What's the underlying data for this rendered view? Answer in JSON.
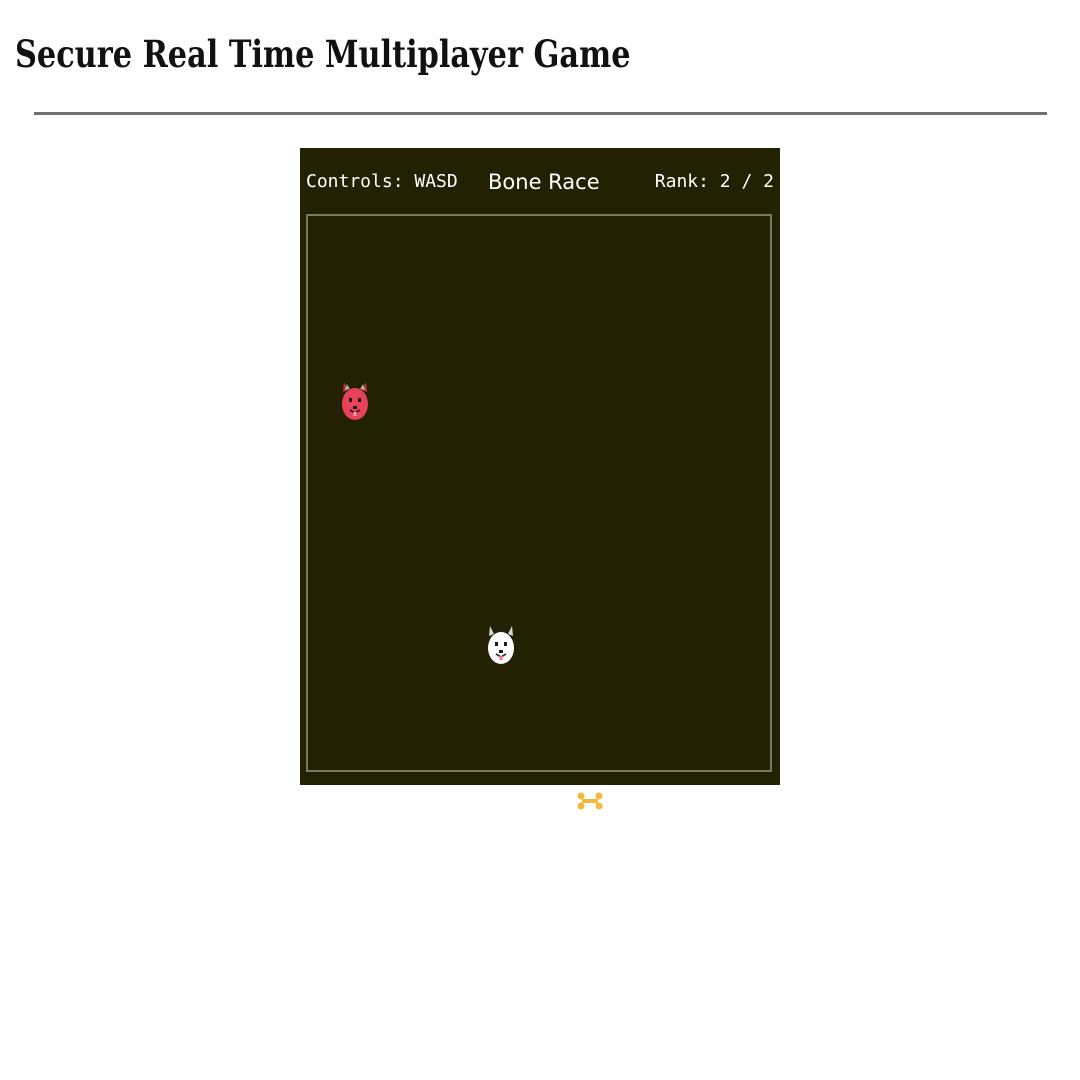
{
  "page": {
    "title": "Secure Real Time Multiplayer Game"
  },
  "game": {
    "hud": {
      "controls": "Controls: WASD",
      "title": "Bone Race",
      "rank": "Rank: 2 / 2"
    },
    "colors": {
      "background": "#222103",
      "arena_border": "#7a7a62",
      "opponent": "#e8415a",
      "player": "#ffffff",
      "bone": "#f2b93d"
    },
    "entities": [
      {
        "name": "opponent-avatar",
        "icon": "red-dog-face-icon"
      },
      {
        "name": "player-avatar",
        "icon": "white-dog-face-icon"
      },
      {
        "name": "collectible",
        "icon": "bone-icon"
      }
    ]
  }
}
